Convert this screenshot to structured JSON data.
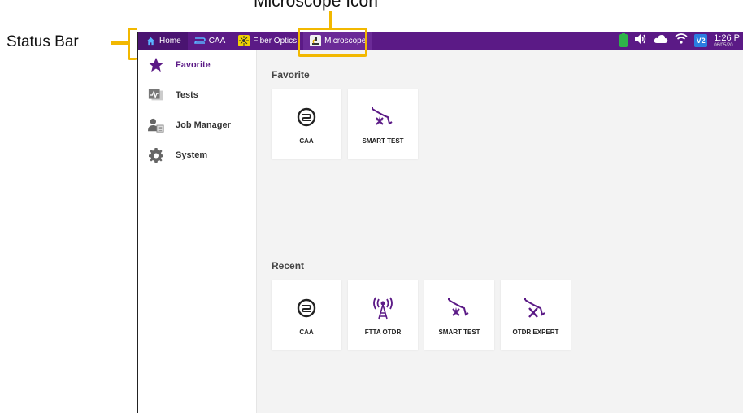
{
  "annotations": {
    "microscope_icon": "Microscope Icon",
    "status_bar": "Status Bar"
  },
  "statusbar": {
    "tabs": [
      {
        "label": "Home",
        "icon": "home-icon"
      },
      {
        "label": "CAA",
        "icon": "caa-icon"
      },
      {
        "label": "Fiber Optics",
        "icon": "fiber-optics-icon"
      },
      {
        "label": "Microscope",
        "icon": "microscope-icon"
      }
    ],
    "clock_time": "1:26 P",
    "clock_date": "06/05/20",
    "badge": "V2"
  },
  "sidebar": {
    "items": [
      {
        "label": "Favorite",
        "icon": "star-icon",
        "active": true
      },
      {
        "label": "Tests",
        "icon": "tests-icon"
      },
      {
        "label": "Job Manager",
        "icon": "job-manager-icon"
      },
      {
        "label": "System",
        "icon": "gear-icon"
      }
    ]
  },
  "main": {
    "favorite_title": "Favorite",
    "favorite_tiles": [
      {
        "label": "CAA",
        "icon": "caa-icon"
      },
      {
        "label": "SMART TEST",
        "icon": "smart-test-icon"
      }
    ],
    "recent_title": "Recent",
    "recent_tiles": [
      {
        "label": "CAA",
        "icon": "caa-icon"
      },
      {
        "label": "FTTA OTDR",
        "icon": "antenna-icon"
      },
      {
        "label": "SMART TEST",
        "icon": "smart-test-icon"
      },
      {
        "label": "OTDR EXPERT",
        "icon": "otdr-expert-icon"
      }
    ]
  },
  "colors": {
    "accent": "#5b1a86",
    "highlight": "#f2b800"
  }
}
